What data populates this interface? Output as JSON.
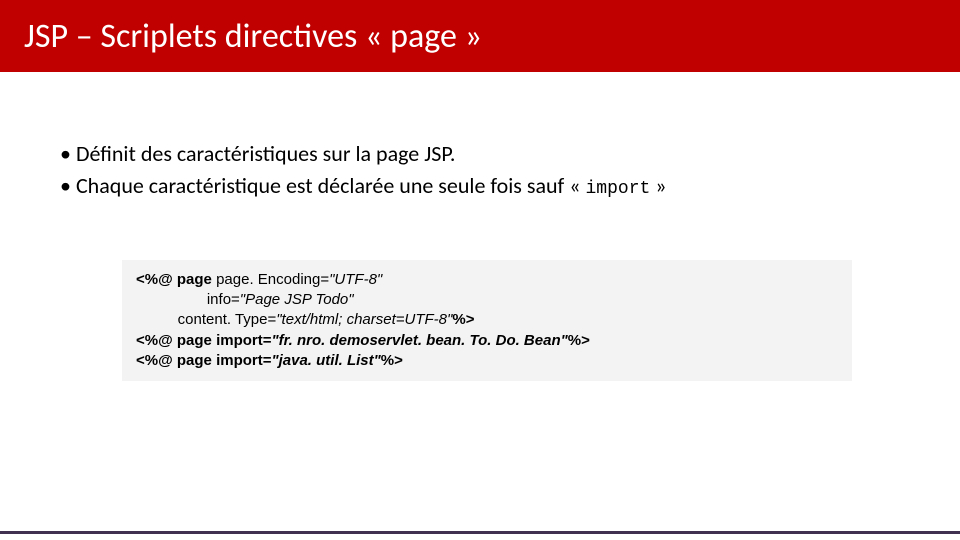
{
  "header": {
    "title": "JSP – Scriplets directives « page »"
  },
  "bullets": [
    {
      "text": "Définit des caractéristiques sur la page JSP."
    },
    {
      "text_pre": "Chaque caractéristique est déclarée une seule fois sauf  « ",
      "code": "import",
      "text_post": " »"
    }
  ],
  "code": {
    "l1a": "<%@ page ",
    "l1b": "page. Encoding=",
    "l1c": "\"UTF-8\"",
    "l2a": "                 info=",
    "l2b": "\"Page JSP Todo\"",
    "l3a": "          content. Type=",
    "l3b": "\"text/html; charset=UTF-8\"",
    "l3c": "%>",
    "l4a": "<%@ page import=",
    "l4b": "\"fr. nro. demoservlet. bean. To. Do. Bean\"",
    "l4c": "%>",
    "l5a": "<%@ page import=",
    "l5b": "\"java. util. List\"",
    "l5c": "%>"
  }
}
